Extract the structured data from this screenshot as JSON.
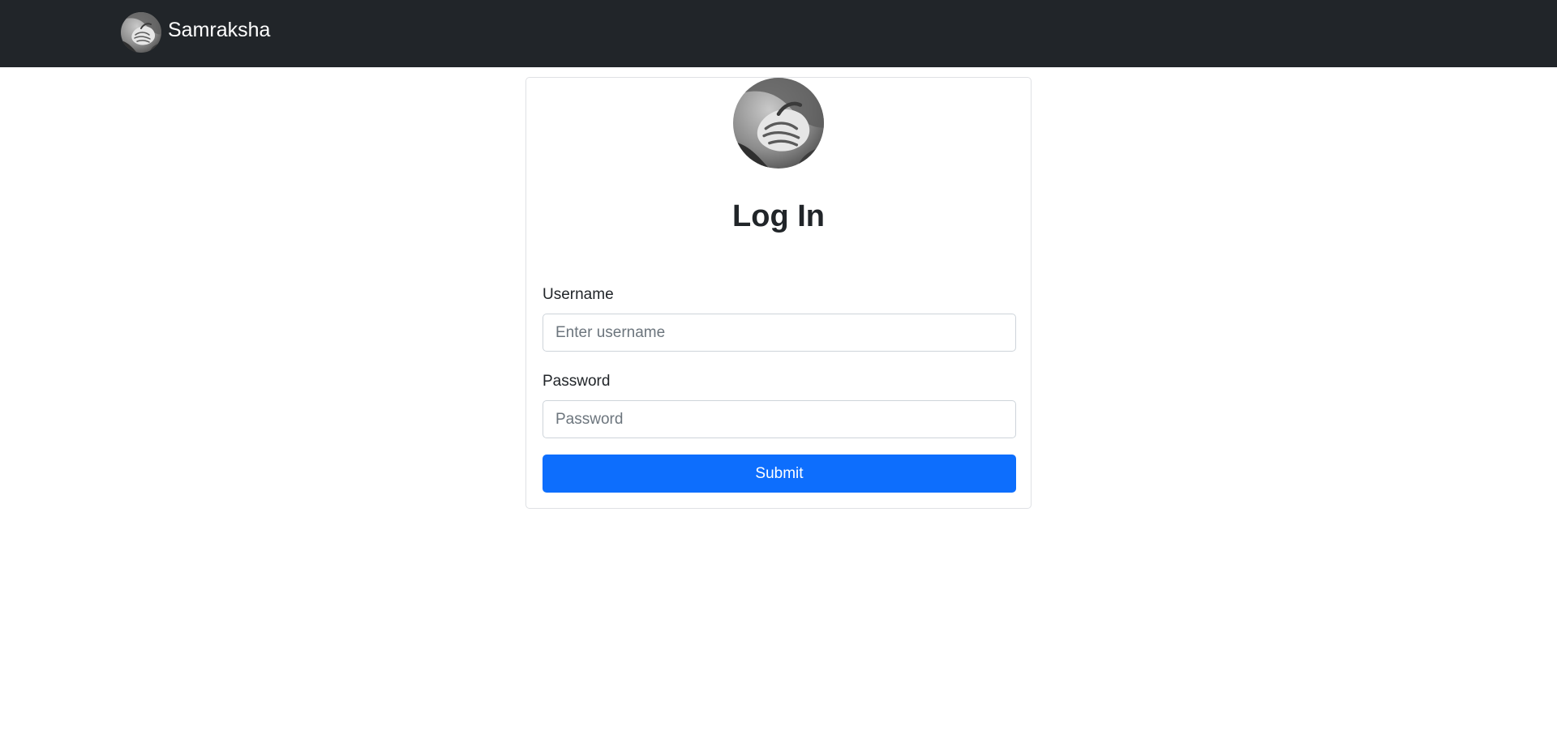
{
  "navbar": {
    "brand_name": "Samraksha",
    "logo_icon": "holding-hands-logo"
  },
  "login": {
    "avatar_icon": "holding-hands-logo",
    "title": "Log In",
    "username_label": "Username",
    "username_placeholder": "Enter username",
    "username_value": "",
    "password_label": "Password",
    "password_placeholder": "Password",
    "password_value": "",
    "submit_label": "Submit"
  },
  "colors": {
    "navbar_bg": "#212529",
    "primary": "#0d6efd",
    "card_border": "#dfe1e4"
  }
}
